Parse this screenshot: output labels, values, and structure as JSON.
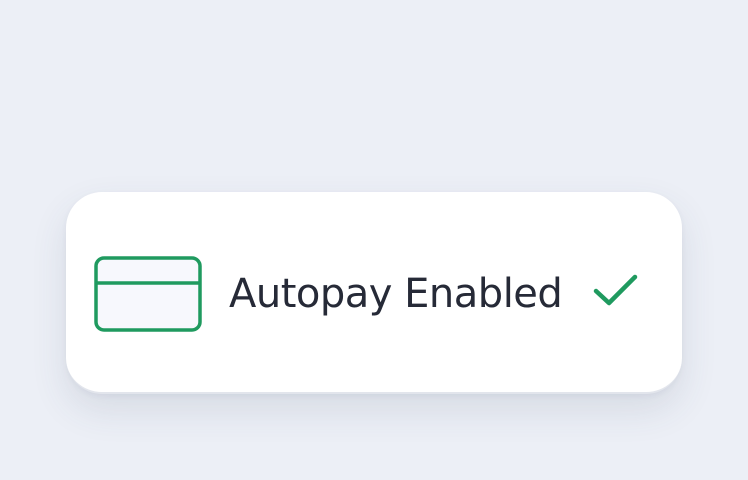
{
  "status_card": {
    "icon": "credit-card-icon",
    "label": "Autopay Enabled",
    "status_icon": "checkmark-icon"
  },
  "colors": {
    "background": "#eceff6",
    "card": "#ffffff",
    "accent_green": "#1f9a5f",
    "text": "#262a37",
    "card_icon_fill": "#f7f8fd"
  }
}
